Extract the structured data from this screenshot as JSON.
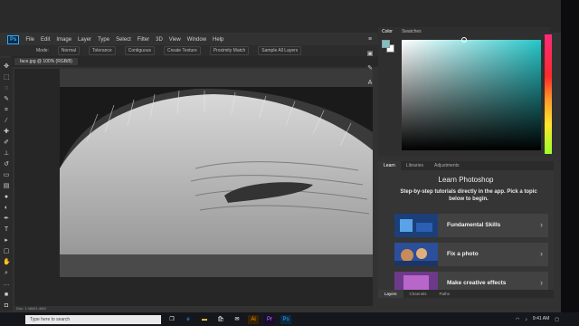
{
  "menubar": {
    "items": [
      "File",
      "Edit",
      "Image",
      "Layer",
      "Type",
      "Select",
      "Filter",
      "3D",
      "View",
      "Window",
      "Help"
    ]
  },
  "options_bar": {
    "items": [
      "Mode:",
      "Normal",
      "Tolerance",
      "Contiguous",
      "Sample All Layers",
      "Create Texture",
      "Proximity Match"
    ]
  },
  "document_tabs": {
    "tabs": [
      "face.jpg @ 100% (RGB/8)"
    ],
    "active_index": 0
  },
  "status_bar": {
    "text": "Doc: 1.46M/1.46M"
  },
  "color_panel": {
    "tabs": [
      "Color",
      "Swatches"
    ],
    "active_tab": "Color",
    "foreground": "#7ac4c8",
    "background": "#ffffff",
    "hue_color": "#27c6c9"
  },
  "learn_panel": {
    "tabs": [
      "Learn",
      "Libraries",
      "Adjustments"
    ],
    "active_tab": "Learn",
    "title": "Learn Photoshop",
    "description": "Step-by-step tutorials directly in the app. Pick a topic below to begin.",
    "cards": [
      {
        "label": "Fundamental Skills",
        "icon": "chevron-right-icon"
      },
      {
        "label": "Fix a photo",
        "icon": "chevron-right-icon"
      },
      {
        "label": "Make creative effects",
        "icon": "chevron-right-icon"
      }
    ]
  },
  "layers_panel": {
    "tabs": [
      "Layers",
      "Channels",
      "Paths"
    ],
    "active_tab": "Layers"
  },
  "taskbar": {
    "search_placeholder": "Type here to search",
    "clock_time": "9:41 AM",
    "icons": [
      "task-view-icon",
      "edge-icon",
      "file-explorer-icon",
      "store-icon",
      "mail-icon",
      "illustrator-icon",
      "premiere-icon",
      "photoshop-icon"
    ]
  }
}
